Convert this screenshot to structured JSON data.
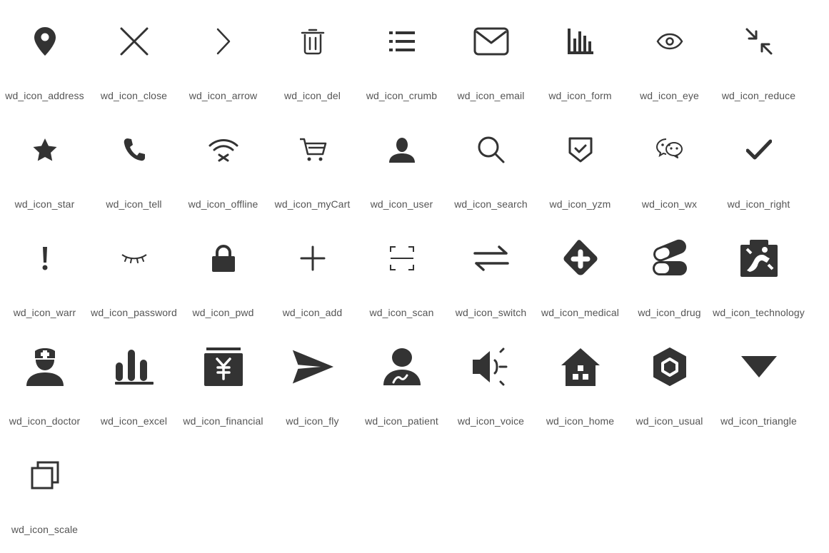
{
  "icon_color": "#333333",
  "label_color": "#555555",
  "icons": [
    {
      "label": "wd_icon_address",
      "icon": "location-pin-icon"
    },
    {
      "label": "wd_icon_close",
      "icon": "close-icon"
    },
    {
      "label": "wd_icon_arrow",
      "icon": "chevron-right-icon"
    },
    {
      "label": "wd_icon_del",
      "icon": "trash-icon"
    },
    {
      "label": "wd_icon_crumb",
      "icon": "list-icon"
    },
    {
      "label": "wd_icon_email",
      "icon": "envelope-icon"
    },
    {
      "label": "wd_icon_form",
      "icon": "bar-chart-icon"
    },
    {
      "label": "wd_icon_eye",
      "icon": "eye-icon"
    },
    {
      "label": "wd_icon_reduce",
      "icon": "collapse-arrows-icon"
    },
    {
      "label": "wd_icon_star",
      "icon": "star-icon"
    },
    {
      "label": "wd_icon_tell",
      "icon": "phone-icon"
    },
    {
      "label": "wd_icon_offline",
      "icon": "wifi-off-icon"
    },
    {
      "label": "wd_icon_myCart",
      "icon": "cart-icon"
    },
    {
      "label": "wd_icon_user",
      "icon": "user-icon"
    },
    {
      "label": "wd_icon_search",
      "icon": "search-icon"
    },
    {
      "label": "wd_icon_yzm",
      "icon": "shield-check-icon"
    },
    {
      "label": "wd_icon_wx",
      "icon": "wechat-icon"
    },
    {
      "label": "wd_icon_right",
      "icon": "checkmark-icon"
    },
    {
      "label": "wd_icon_warr",
      "icon": "exclamation-icon"
    },
    {
      "label": "wd_icon_password",
      "icon": "closed-eye-icon"
    },
    {
      "label": "wd_icon_pwd",
      "icon": "lock-icon"
    },
    {
      "label": "wd_icon_add",
      "icon": "plus-icon"
    },
    {
      "label": "wd_icon_scan",
      "icon": "scan-icon"
    },
    {
      "label": "wd_icon_switch",
      "icon": "switch-arrows-icon"
    },
    {
      "label": "wd_icon_medical",
      "icon": "medical-cross-icon"
    },
    {
      "label": "wd_icon_drug",
      "icon": "pills-icon"
    },
    {
      "label": "wd_icon_technology",
      "icon": "technology-icon"
    },
    {
      "label": "wd_icon_doctor",
      "icon": "doctor-icon"
    },
    {
      "label": "wd_icon_excel",
      "icon": "excel-bars-icon"
    },
    {
      "label": "wd_icon_financial",
      "icon": "financial-yen-icon"
    },
    {
      "label": "wd_icon_fly",
      "icon": "paper-plane-icon"
    },
    {
      "label": "wd_icon_patient",
      "icon": "patient-icon"
    },
    {
      "label": "wd_icon_voice",
      "icon": "speaker-icon"
    },
    {
      "label": "wd_icon_home",
      "icon": "home-icon"
    },
    {
      "label": "wd_icon_usual",
      "icon": "hexagon-icon"
    },
    {
      "label": "wd_icon_triangle",
      "icon": "triangle-down-icon"
    },
    {
      "label": "wd_icon_scale",
      "icon": "overlap-squares-icon"
    }
  ]
}
